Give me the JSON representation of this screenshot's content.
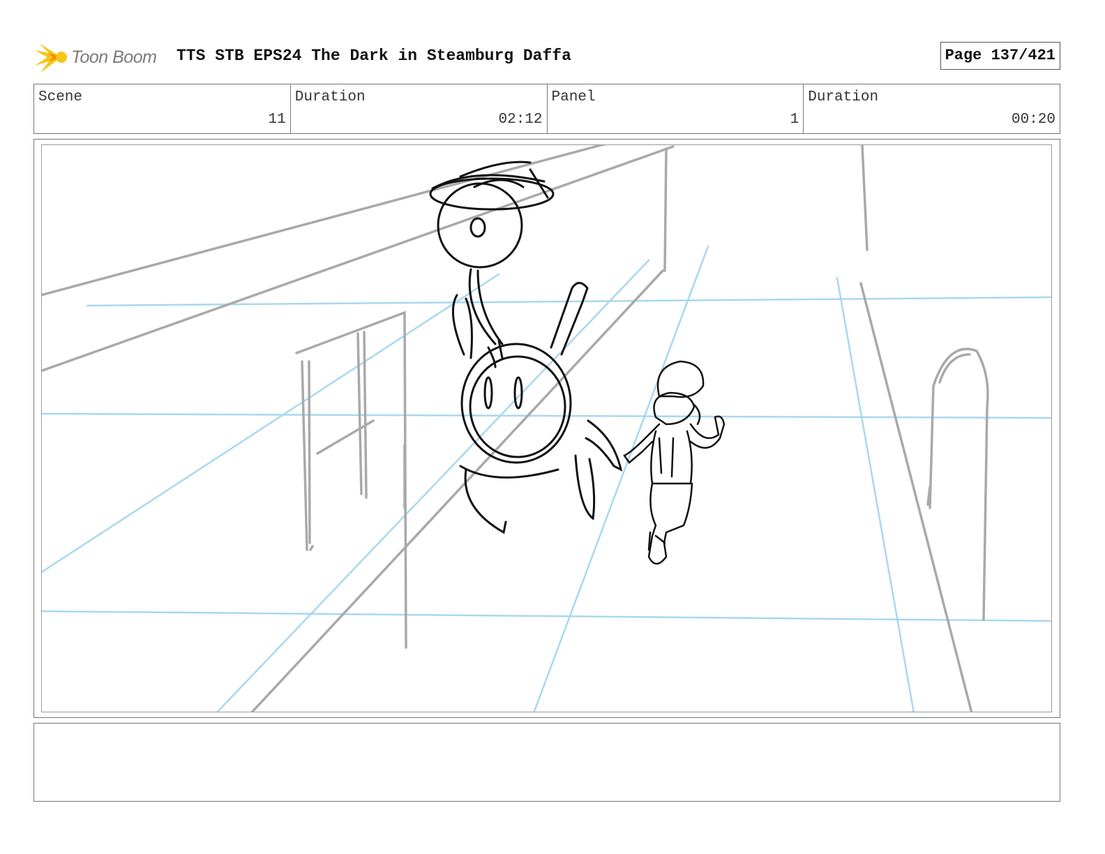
{
  "header": {
    "logo_text": "Toon Boom",
    "title": "TTS STB EPS24 The Dark in Steamburg Daffa",
    "page": "Page 137/421"
  },
  "info": {
    "scene_label": "Scene",
    "scene_value": "11",
    "duration_label": "Duration",
    "duration_value": "02:12",
    "panel_label": "Panel",
    "panel_value": "1",
    "panel_duration_label": "Duration",
    "panel_duration_value": "00:20"
  },
  "colors": {
    "logo_accent": "#f5c518",
    "sketch_line": "#111111",
    "background_line": "#a9a9a9",
    "perspective_guide": "#a8d8f0"
  },
  "notes": {
    "text": ""
  }
}
